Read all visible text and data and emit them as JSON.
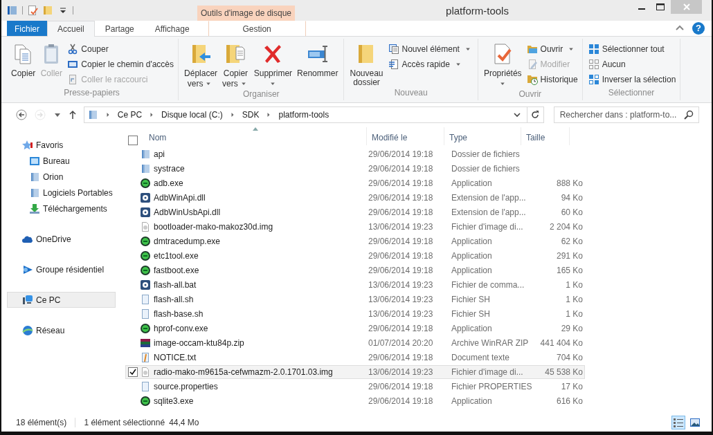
{
  "window": {
    "title": "platform-tools"
  },
  "contextual_group": {
    "label": "Outils d'image de disque"
  },
  "tabs": [
    {
      "label": "Fichier",
      "kind": "file",
      "selected": false
    },
    {
      "label": "Accueil",
      "kind": "tab",
      "selected": true
    },
    {
      "label": "Partage",
      "kind": "tab",
      "selected": false
    },
    {
      "label": "Affichage",
      "kind": "tab",
      "selected": false
    },
    {
      "label": "Gestion",
      "kind": "contextual",
      "selected": false
    }
  ],
  "help_button": {
    "label": "?"
  },
  "ribbon_groups": [
    {
      "label": "Presse-papiers",
      "large_buttons": [
        {
          "label_lines": [
            "Copier"
          ],
          "disabled": false,
          "dropdown": false
        },
        {
          "label_lines": [
            "Coller"
          ],
          "disabled": true,
          "dropdown": false
        }
      ],
      "small_buttons": [
        {
          "label": "Couper",
          "disabled": false,
          "dropdown": false
        },
        {
          "label": "Copier le chemin d'accès",
          "disabled": false,
          "dropdown": false
        },
        {
          "label": "Coller le raccourci",
          "disabled": true,
          "dropdown": false
        }
      ]
    },
    {
      "label": "Organiser",
      "large_buttons": [
        {
          "label_lines": [
            "Déplacer",
            "vers"
          ],
          "disabled": false,
          "dropdown": true
        },
        {
          "label_lines": [
            "Copier",
            "vers"
          ],
          "disabled": false,
          "dropdown": true
        },
        {
          "label_lines": [
            "Supprimer"
          ],
          "disabled": false,
          "dropdown": true
        },
        {
          "label_lines": [
            "Renommer"
          ],
          "disabled": false,
          "dropdown": false
        }
      ]
    },
    {
      "label": "Nouveau",
      "large_buttons": [
        {
          "label_lines": [
            "Nouveau",
            "dossier"
          ],
          "disabled": false,
          "dropdown": false
        }
      ],
      "small_buttons": [
        {
          "label": "Nouvel élément",
          "disabled": false,
          "dropdown": true
        },
        {
          "label": "Accès rapide",
          "disabled": false,
          "dropdown": true
        }
      ]
    },
    {
      "label": "Ouvrir",
      "large_buttons": [
        {
          "label_lines": [
            "Propriétés"
          ],
          "disabled": false,
          "dropdown": true
        }
      ],
      "small_buttons": [
        {
          "label": "Ouvrir",
          "disabled": false,
          "dropdown": true
        },
        {
          "label": "Modifier",
          "disabled": true,
          "dropdown": false
        },
        {
          "label": "Historique",
          "disabled": false,
          "dropdown": false
        }
      ]
    },
    {
      "label": "Sélectionner",
      "small_buttons": [
        {
          "label": "Sélectionner tout",
          "disabled": false,
          "dropdown": false
        },
        {
          "label": "Aucun",
          "disabled": false,
          "dropdown": false
        },
        {
          "label": "Inverser la sélection",
          "disabled": false,
          "dropdown": false
        }
      ]
    }
  ],
  "navigation_buttons": [
    {
      "kind": "back",
      "disabled": false
    },
    {
      "kind": "forward",
      "disabled": true
    }
  ],
  "breadcrumb": [
    "Ce PC",
    "Disque local (C:)",
    "SDK",
    "platform-tools"
  ],
  "search": {
    "placeholder": "Rechercher dans : platform-to..."
  },
  "navigation": [
    {
      "label": "Favoris",
      "selected": false,
      "children": [
        {
          "label": "Bureau",
          "selected": false
        },
        {
          "label": "Orion",
          "selected": false
        },
        {
          "label": "Logiciels Portables",
          "selected": false
        },
        {
          "label": "Téléchargements",
          "selected": false
        }
      ]
    },
    {
      "label": "OneDrive",
      "selected": false
    },
    {
      "label": "Groupe résidentiel",
      "selected": false
    },
    {
      "label": "Ce PC",
      "selected": true
    },
    {
      "label": "Réseau",
      "selected": false
    }
  ],
  "table": {
    "select_all_checked": false,
    "columns": [
      {
        "label": "Nom",
        "sorted": true
      },
      {
        "label": "Modifié le",
        "sorted": false
      },
      {
        "label": "Type",
        "sorted": false
      },
      {
        "label": "Taille",
        "sorted": false
      }
    ]
  },
  "files": [
    {
      "name": "api",
      "modified": "29/06/2014 19:18",
      "type": "Dossier de fichiers",
      "kind": "folder",
      "selected": false
    },
    {
      "name": "systrace",
      "modified": "29/06/2014 19:18",
      "type": "Dossier de fichiers",
      "kind": "folder",
      "selected": false
    },
    {
      "name": "adb.exe",
      "modified": "29/06/2014 19:18",
      "type": "Application",
      "size": "888 Ko",
      "kind": "exe",
      "selected": false
    },
    {
      "name": "AdbWinApi.dll",
      "modified": "29/06/2014 19:18",
      "type": "Extension de l'app...",
      "size": "94 Ko",
      "kind": "dll",
      "selected": false
    },
    {
      "name": "AdbWinUsbApi.dll",
      "modified": "29/06/2014 19:18",
      "type": "Extension de l'app...",
      "size": "60 Ko",
      "kind": "dll",
      "selected": false
    },
    {
      "name": "bootloader-mako-makoz30d.img",
      "modified": "13/06/2014 19:23",
      "type": "Fichier d'image di...",
      "size": "2 204 Ko",
      "kind": "img",
      "selected": false
    },
    {
      "name": "dmtracedump.exe",
      "modified": "29/06/2014 19:18",
      "type": "Application",
      "size": "62 Ko",
      "kind": "exe",
      "selected": false
    },
    {
      "name": "etc1tool.exe",
      "modified": "29/06/2014 19:18",
      "type": "Application",
      "size": "291 Ko",
      "kind": "exe",
      "selected": false
    },
    {
      "name": "fastboot.exe",
      "modified": "29/06/2014 19:18",
      "type": "Application",
      "size": "165 Ko",
      "kind": "exe",
      "selected": false
    },
    {
      "name": "flash-all.bat",
      "modified": "13/06/2014 19:23",
      "type": "Fichier de comma...",
      "size": "1 Ko",
      "kind": "bat",
      "selected": false
    },
    {
      "name": "flash-all.sh",
      "modified": "13/06/2014 19:23",
      "type": "Fichier SH",
      "size": "1 Ko",
      "kind": "sh",
      "selected": false
    },
    {
      "name": "flash-base.sh",
      "modified": "13/06/2014 19:23",
      "type": "Fichier SH",
      "size": "1 Ko",
      "kind": "sh",
      "selected": false
    },
    {
      "name": "hprof-conv.exe",
      "modified": "29/06/2014 19:18",
      "type": "Application",
      "size": "29 Ko",
      "kind": "exe",
      "selected": false
    },
    {
      "name": "image-occam-ktu84p.zip",
      "modified": "01/07/2014 20:20",
      "type": "Archive WinRAR ZIP",
      "size": "441 404 Ko",
      "kind": "zip",
      "selected": false
    },
    {
      "name": "NOTICE.txt",
      "modified": "29/06/2014 19:18",
      "type": "Document texte",
      "size": "704 Ko",
      "kind": "txt",
      "selected": false
    },
    {
      "name": "radio-mako-m9615a-cefwmazm-2.0.1701.03.img",
      "modified": "13/06/2014 19:23",
      "type": "Fichier d'image di...",
      "size": "45 538 Ko",
      "kind": "img",
      "selected": true
    },
    {
      "name": "source.properties",
      "modified": "29/06/2014 19:18",
      "type": "Fichier PROPERTIES",
      "size": "17 Ko",
      "kind": "sh",
      "selected": false
    },
    {
      "name": "sqlite3.exe",
      "modified": "29/06/2014 19:18",
      "type": "Application",
      "size": "616 Ko",
      "kind": "exe",
      "selected": false
    }
  ],
  "status_bar": {
    "item_count": "18 élément(s)",
    "selection": "1 élément sélectionné",
    "selection_size": "44,4 Mo"
  },
  "view_buttons": [
    {
      "selected": true
    },
    {
      "selected": false
    }
  ]
}
